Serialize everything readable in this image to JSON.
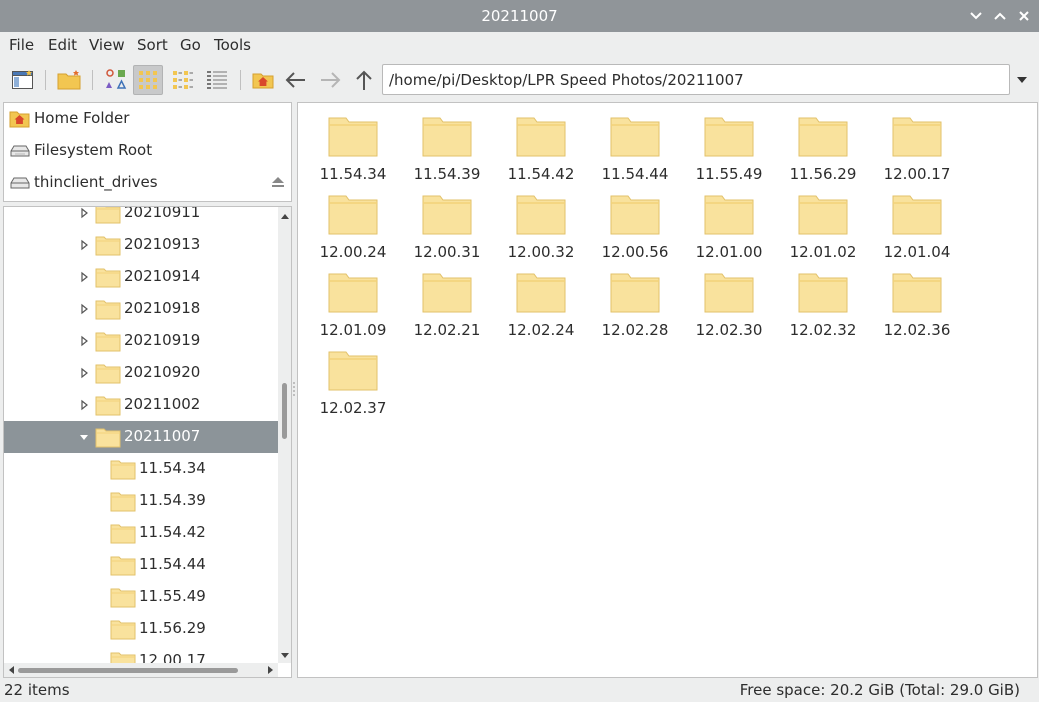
{
  "window": {
    "title": "20211007"
  },
  "menu": {
    "items": [
      "File",
      "Edit",
      "View",
      "Sort",
      "Go",
      "Tools"
    ]
  },
  "toolbar": {
    "path": "/home/pi/Desktop/LPR Speed Photos/20211007",
    "icons": [
      "new-window-icon",
      "new-folder-icon",
      "icon-view-icon",
      "thumbnail-view-icon",
      "compact-view-icon",
      "list-view-icon",
      "home-icon",
      "back-arrow-icon",
      "forward-arrow-icon",
      "up-arrow-icon"
    ],
    "active_view": "thumbnail-view-icon"
  },
  "places": [
    {
      "label": "Home Folder",
      "icon": "home-folder-icon"
    },
    {
      "label": "Filesystem Root",
      "icon": "drive-icon"
    },
    {
      "label": "thinclient_drives",
      "icon": "drive-icon",
      "eject": true
    }
  ],
  "tree": {
    "items": [
      {
        "label": "20210911",
        "expandable": true
      },
      {
        "label": "20210913",
        "expandable": true
      },
      {
        "label": "20210914",
        "expandable": true
      },
      {
        "label": "20210918",
        "expandable": true
      },
      {
        "label": "20210919",
        "expandable": true
      },
      {
        "label": "20210920",
        "expandable": true
      },
      {
        "label": "20211002",
        "expandable": true
      },
      {
        "label": "20211007",
        "expandable": true,
        "expanded": true,
        "selected": true
      },
      {
        "label": "11.54.34",
        "child": true
      },
      {
        "label": "11.54.39",
        "child": true
      },
      {
        "label": "11.54.42",
        "child": true
      },
      {
        "label": "11.54.44",
        "child": true
      },
      {
        "label": "11.55.49",
        "child": true
      },
      {
        "label": "11.56.29",
        "child": true
      },
      {
        "label": "12.00.17",
        "child": true
      }
    ]
  },
  "folders": [
    "11.54.34",
    "11.54.39",
    "11.54.42",
    "11.54.44",
    "11.55.49",
    "11.56.29",
    "12.00.17",
    "12.00.24",
    "12.00.31",
    "12.00.32",
    "12.00.56",
    "12.01.00",
    "12.01.02",
    "12.01.04",
    "12.01.09",
    "12.02.21",
    "12.02.24",
    "12.02.28",
    "12.02.30",
    "12.02.32",
    "12.02.36",
    "12.02.37"
  ],
  "status": {
    "items": "22 items",
    "free_space": "Free space: 20.2 GiB (Total: 29.0 GiB)"
  },
  "colors": {
    "titlebar": "#909599",
    "selection": "#8c9499",
    "folder_fill": "#f9e29d",
    "folder_tab": "#f2d27a",
    "home_red": "#d9472b"
  }
}
